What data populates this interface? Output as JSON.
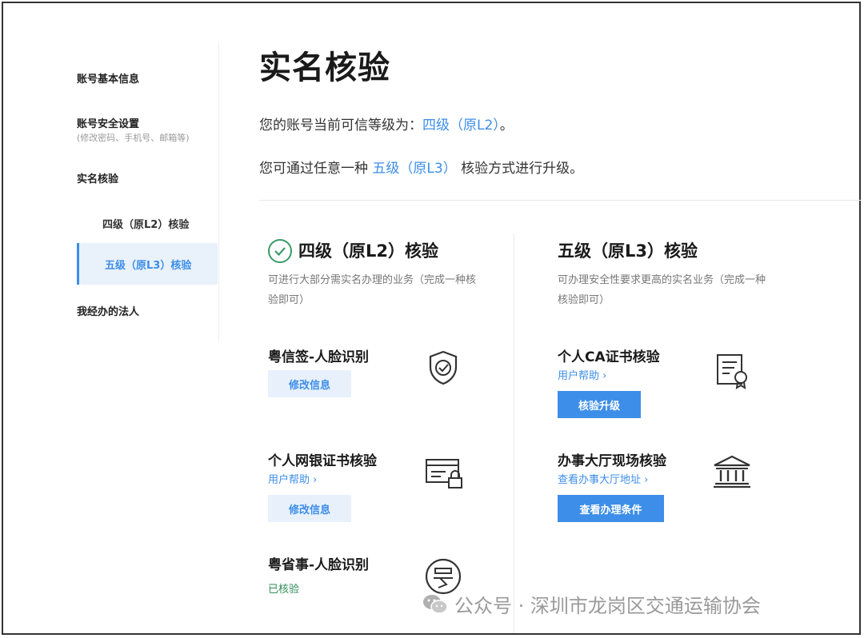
{
  "sidebar": {
    "items": [
      {
        "label": "账号基本信息"
      },
      {
        "label": "账号安全设置",
        "sub": "(修改密码、手机号、邮箱等)"
      },
      {
        "label": "实名核验"
      },
      {
        "label": "四级（原L2）核验"
      },
      {
        "label": "五级（原L3）核验",
        "active": true
      },
      {
        "label": "我经办的法人"
      }
    ]
  },
  "main": {
    "title": "实名核验",
    "level_line_prefix": "您的账号当前可信等级为：",
    "level_line_value": "四级（原L2）",
    "level_line_suffix": "。",
    "upgrade_line_prefix": "您可通过任意一种",
    "upgrade_line_value": "五级（原L3）",
    "upgrade_line_suffix": "核验方式进行升级。"
  },
  "left_col": {
    "title": "四级（原L2）核验",
    "desc": "可进行大部分需实名办理的业务（完成一种核验即可）",
    "items": [
      {
        "title": "粤信签-人脸识别",
        "button": "修改信息",
        "icon": "shield-check-icon"
      },
      {
        "title": "个人网银证书核验",
        "link": "用户帮助 ›",
        "button": "修改信息",
        "icon": "card-lock-icon"
      },
      {
        "title": "粤省事-人脸识别",
        "status": "已核验",
        "icon": "yue-logo-icon"
      }
    ]
  },
  "right_col": {
    "title": "五级（原L3）核验",
    "desc": "可办理安全性要求更高的实名业务（完成一种核验即可）",
    "items": [
      {
        "title": "个人CA证书核验",
        "link": "用户帮助 ›",
        "button": "核验升级",
        "icon": "certificate-icon"
      },
      {
        "title": "办事大厅现场核验",
        "link": "查看办事大厅地址 ›",
        "button": "查看办理条件",
        "icon": "bank-building-icon"
      }
    ]
  },
  "watermark": "公众号 · 深圳市龙岗区交通运输协会",
  "colors": {
    "accent": "#3d8ee8",
    "success": "#2e8b57",
    "active_bg": "#e9f1fa"
  }
}
